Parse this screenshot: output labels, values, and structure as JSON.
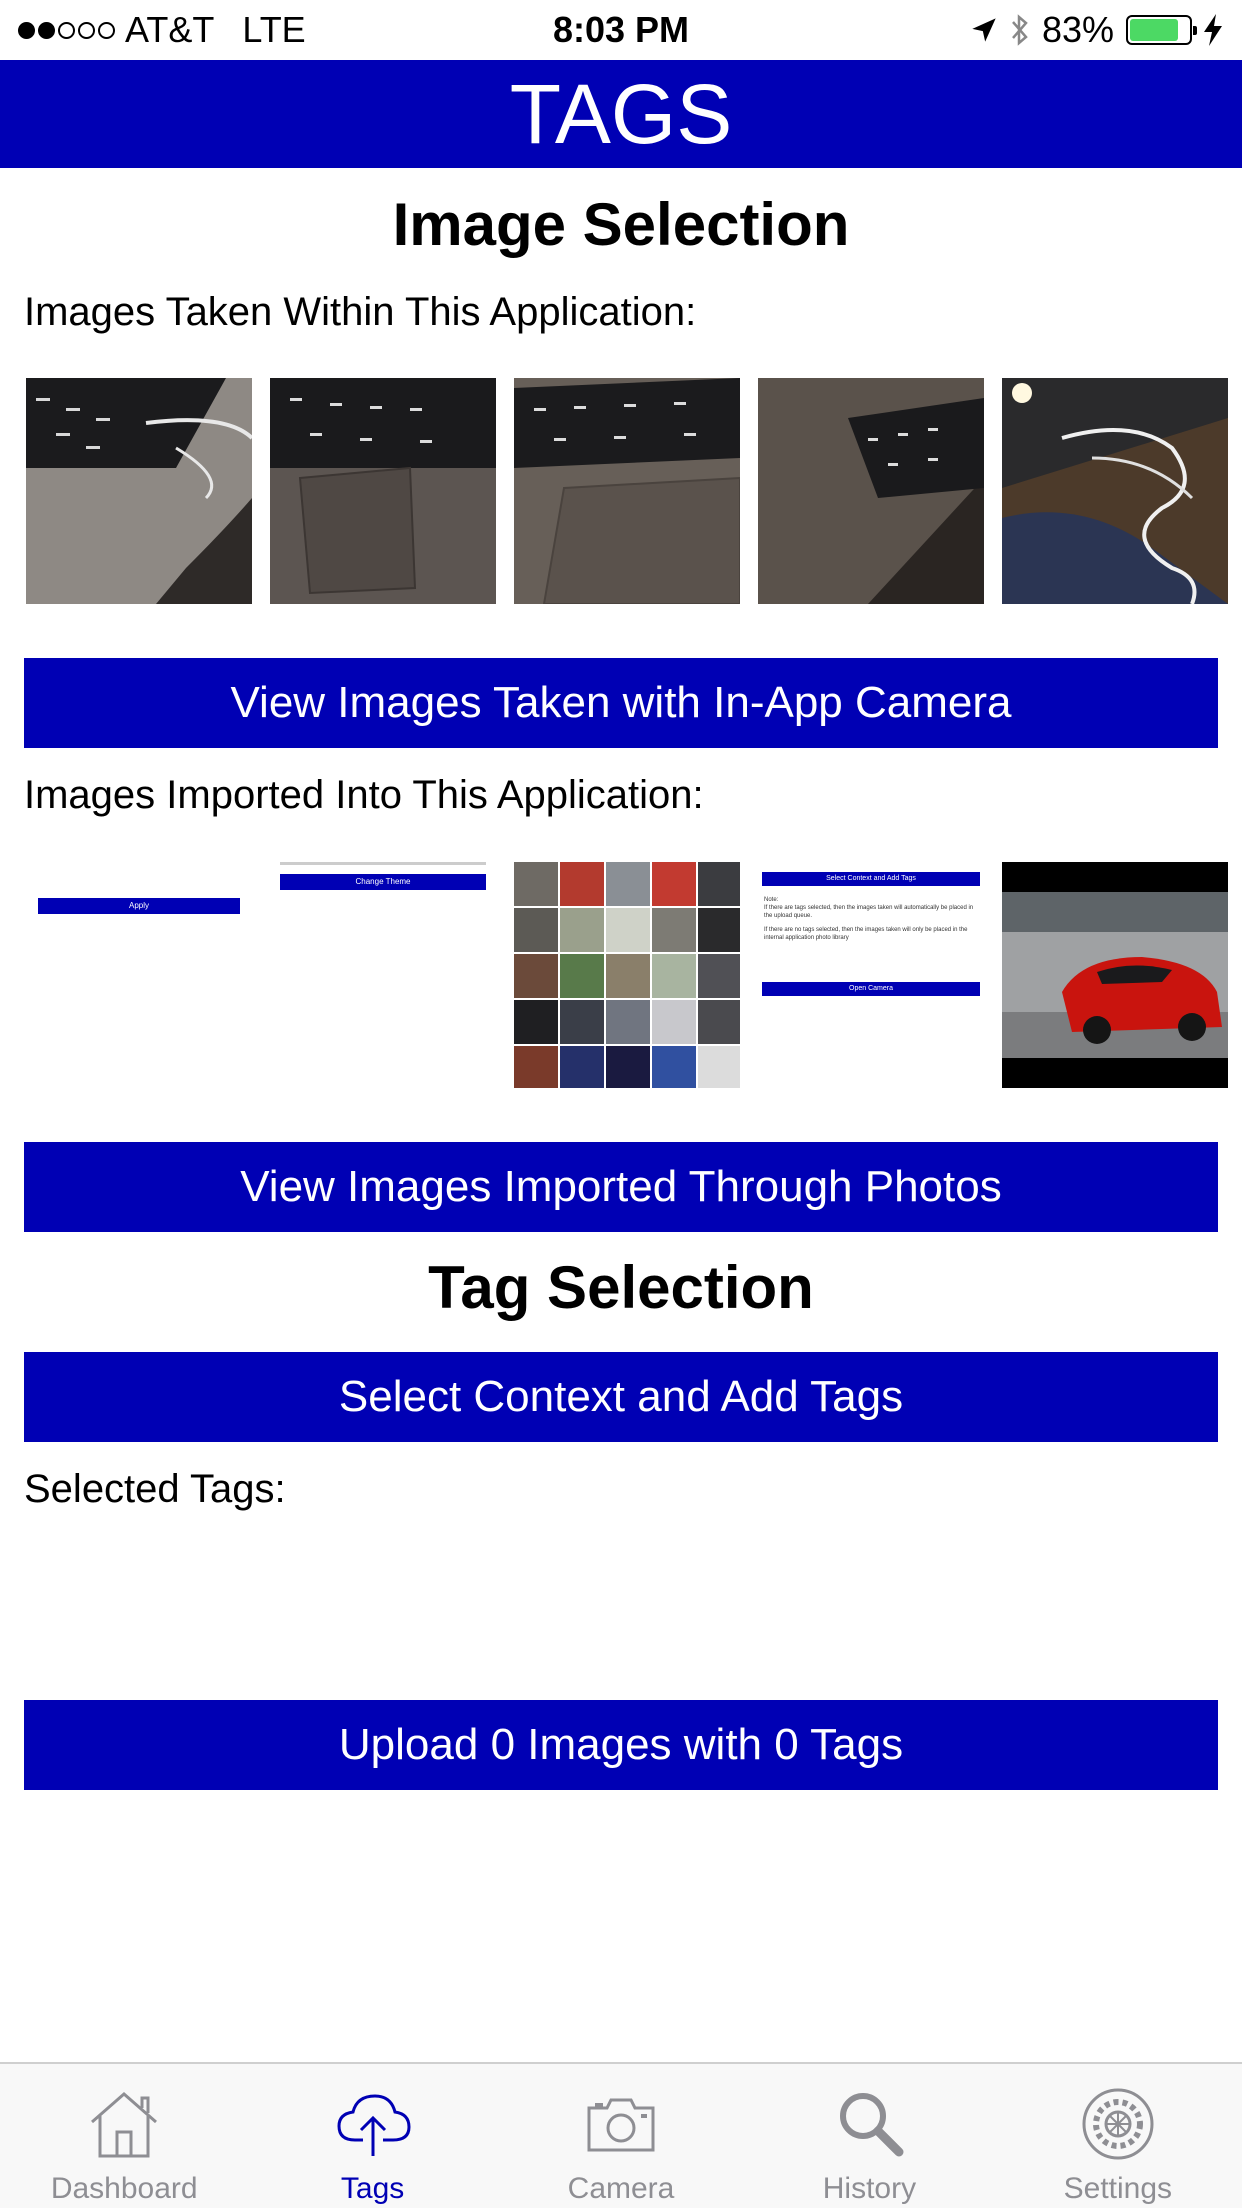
{
  "status_bar": {
    "carrier": "AT&T",
    "network": "LTE",
    "time": "8:03 PM",
    "battery_percent": "83%",
    "battery_level": 0.83,
    "signal_bars_filled": 2,
    "signal_bars_total": 5
  },
  "nav": {
    "title": "TAGS"
  },
  "image_selection": {
    "title": "Image Selection",
    "taken_label": "Images Taken Within This Application:",
    "view_taken_button": "View Images Taken with In-App Camera",
    "imported_label": "Images Imported Into This Application:",
    "view_imported_button": "View Images Imported Through Photos",
    "imported_thumbs": {
      "apply_label": "Apply",
      "change_theme_label": "Change Theme",
      "select_context_label": "Select Context and Add Tags",
      "note_label": "Note:",
      "note_line_1": "If there are tags selected, then the images taken will automatically be placed in the upload queue.",
      "note_line_2": "If there are no tags selected, then the images taken will only be placed in the internal application photo library",
      "open_camera_label": "Open Camera"
    }
  },
  "tag_selection": {
    "title": "Tag Selection",
    "select_button": "Select Context and Add Tags",
    "selected_label": "Selected Tags:",
    "upload_button": "Upload 0 Images with 0 Tags"
  },
  "tab_bar": {
    "items": [
      {
        "label": "Dashboard",
        "icon": "house-icon"
      },
      {
        "label": "Tags",
        "icon": "cloud-upload-icon",
        "active": true
      },
      {
        "label": "Camera",
        "icon": "camera-icon"
      },
      {
        "label": "History",
        "icon": "magnifier-icon"
      },
      {
        "label": "Settings",
        "icon": "gear-icon"
      }
    ]
  },
  "colors": {
    "accent": "#0000b4",
    "tab_inactive": "#8e8e93",
    "battery": "#4cd964"
  }
}
